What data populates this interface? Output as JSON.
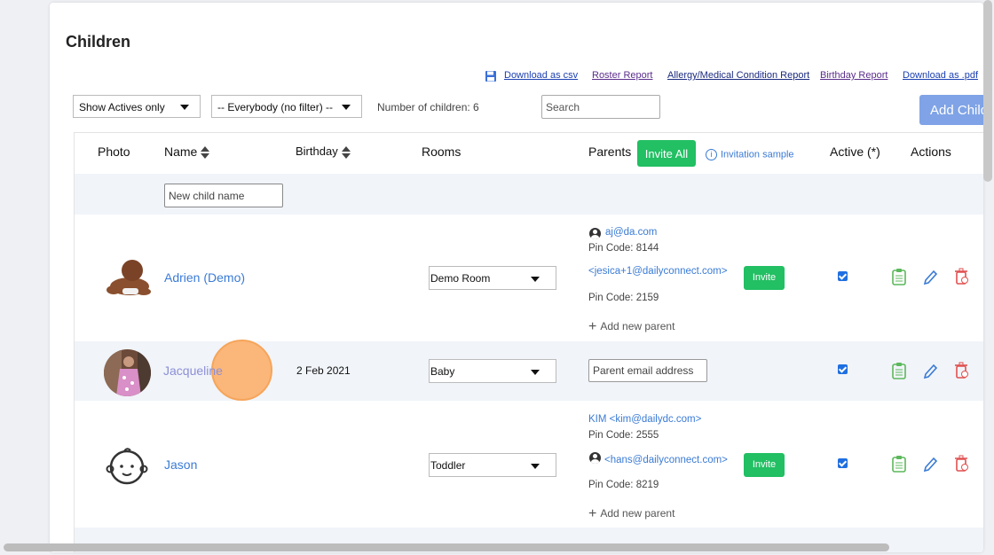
{
  "page": {
    "title": "Children"
  },
  "links": {
    "download_csv": "Download as csv",
    "roster_report": "Roster Report",
    "allergy_report": "Allergy/Medical Condition Report",
    "birthday_report": "Birthday Report",
    "download_pdf": "Download as .pdf"
  },
  "filters": {
    "actives": "Show Actives only",
    "everybody": "-- Everybody (no filter) --",
    "count_label": "Number of children: 6",
    "search_placeholder": "Search",
    "add_child": "Add Child"
  },
  "table": {
    "headers": {
      "photo": "Photo",
      "name": "Name",
      "birthday": "Birthday",
      "rooms": "Rooms",
      "parents": "Parents",
      "invite_all": "Invite All",
      "invitation_sample": "Invitation sample",
      "active": "Active (*)",
      "actions": "Actions"
    },
    "new_child_placeholder": "New child name",
    "rows": [
      {
        "name": "Adrien (Demo)",
        "birthday": "",
        "room": "Demo Room",
        "parents": [
          {
            "email": "aj@da.com",
            "pin": "Pin Code: 8144",
            "has_account": true
          },
          {
            "email": "<jesica+1@dailyconnect.com>",
            "pin": "Pin Code: 2159",
            "invite": "Invite"
          }
        ],
        "add_parent": "Add new parent",
        "active": true
      },
      {
        "name": "Jacqueline",
        "birthday": "2 Feb 2021",
        "room": "Baby",
        "parent_email_placeholder": "Parent email address",
        "active": true
      },
      {
        "name": "Jason",
        "birthday": "",
        "room": "Toddler",
        "parents": [
          {
            "email": "KIM <kim@dailydc.com>",
            "pin": "Pin Code: 2555"
          },
          {
            "email": "<hans@dailyconnect.com>",
            "pin": "Pin Code: 8219",
            "invite": "Invite",
            "has_account": true
          }
        ],
        "add_parent": "Add new parent",
        "active": true
      }
    ]
  },
  "colors": {
    "accent_blue": "#3a7bd5",
    "green": "#22bf63",
    "add_child_button": "#7fa3e6",
    "row_alt": "#f1f4f9",
    "highlight": "#fdaa64"
  }
}
